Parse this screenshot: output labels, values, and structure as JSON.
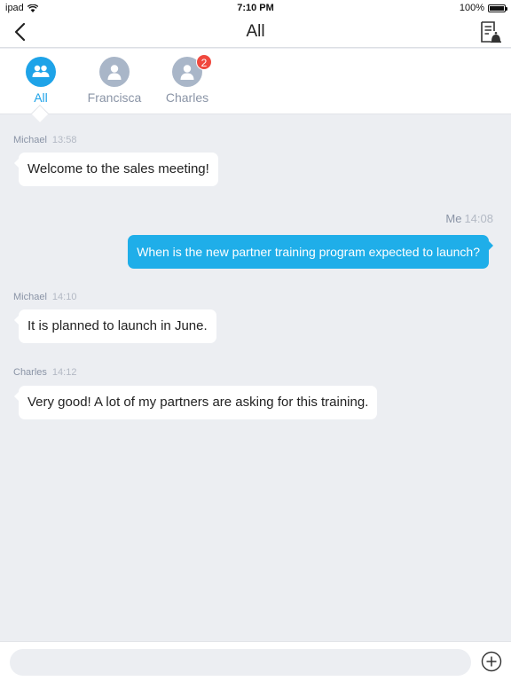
{
  "status_bar": {
    "device": "ipad",
    "time": "7:10 PM",
    "battery": "100%"
  },
  "nav": {
    "title": "All",
    "icons": {
      "back": "chevron-left-icon",
      "notes": "document-icon"
    }
  },
  "tabs": [
    {
      "label": "All",
      "icon": "group-icon",
      "active": true
    },
    {
      "label": "Francisca",
      "icon": "person-icon",
      "active": false
    },
    {
      "label": "Charles",
      "icon": "person-icon",
      "active": false,
      "badge": "2"
    }
  ],
  "messages": [
    {
      "sender": "Michael",
      "time": "13:58",
      "text": "Welcome to the sales meeting!",
      "direction": "in"
    },
    {
      "sender": "Me",
      "time": "14:08",
      "text": "When is the new partner training  program expected to launch?",
      "direction": "out"
    },
    {
      "sender": "Michael",
      "time": "14:10",
      "text": "It is planned to launch in June.",
      "direction": "in"
    },
    {
      "sender": "Charles",
      "time": "14:12",
      "text": "Very good! A lot of my partners are asking for this training.",
      "direction": "in"
    }
  ],
  "composer": {
    "value": "",
    "placeholder": ""
  },
  "colors": {
    "accent": "#1ea3e8",
    "outgoing_bubble": "#1faee9",
    "badge": "#f0483e",
    "background": "#eceef2",
    "avatar": "#a9b6c8"
  }
}
